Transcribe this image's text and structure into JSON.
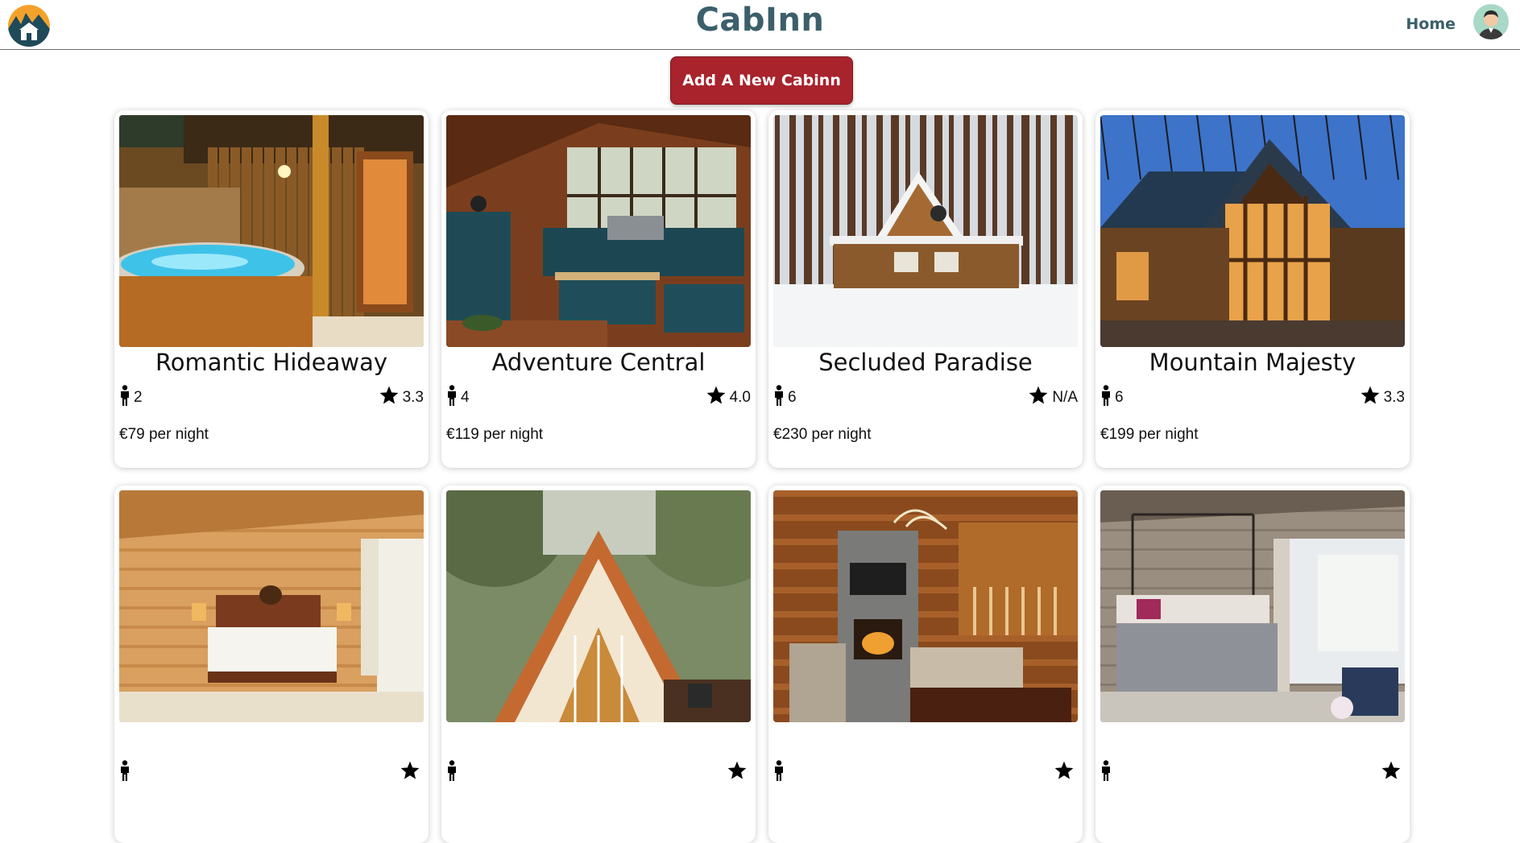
{
  "app": {
    "brand": "CabInn"
  },
  "nav": {
    "home_label": "Home"
  },
  "actions": {
    "add_label": "Add A New Cabinn"
  },
  "cabins": [
    {
      "title": "Romantic Hideaway",
      "guests": "2",
      "rating": "3.3",
      "price": "€79 per night",
      "photo": "hot-tub-photo"
    },
    {
      "title": "Adventure Central",
      "guests": "4",
      "rating": "4.0",
      "price": "€119 per night",
      "photo": "kitchen-photo"
    },
    {
      "title": "Secluded Paradise",
      "guests": "6",
      "rating": "N/A",
      "price": "€230 per night",
      "photo": "snow-cabin-photo"
    },
    {
      "title": "Mountain Majesty",
      "guests": "6",
      "rating": "3.3",
      "price": "€199 per night",
      "photo": "night-lodge-photo"
    },
    {
      "title": "",
      "guests": "",
      "rating": "",
      "price": "",
      "photo": "log-bedroom-photo"
    },
    {
      "title": "",
      "guests": "",
      "rating": "",
      "price": "",
      "photo": "a-frame-photo"
    },
    {
      "title": "",
      "guests": "",
      "rating": "",
      "price": "",
      "photo": "living-room-photo"
    },
    {
      "title": "",
      "guests": "",
      "rating": "",
      "price": "",
      "photo": "canopy-bedroom-photo"
    }
  ],
  "icons": {
    "guests": "person-icon",
    "rating": "star-icon"
  },
  "colors": {
    "brand": "#3b5f6b",
    "button": "#a8232c"
  }
}
